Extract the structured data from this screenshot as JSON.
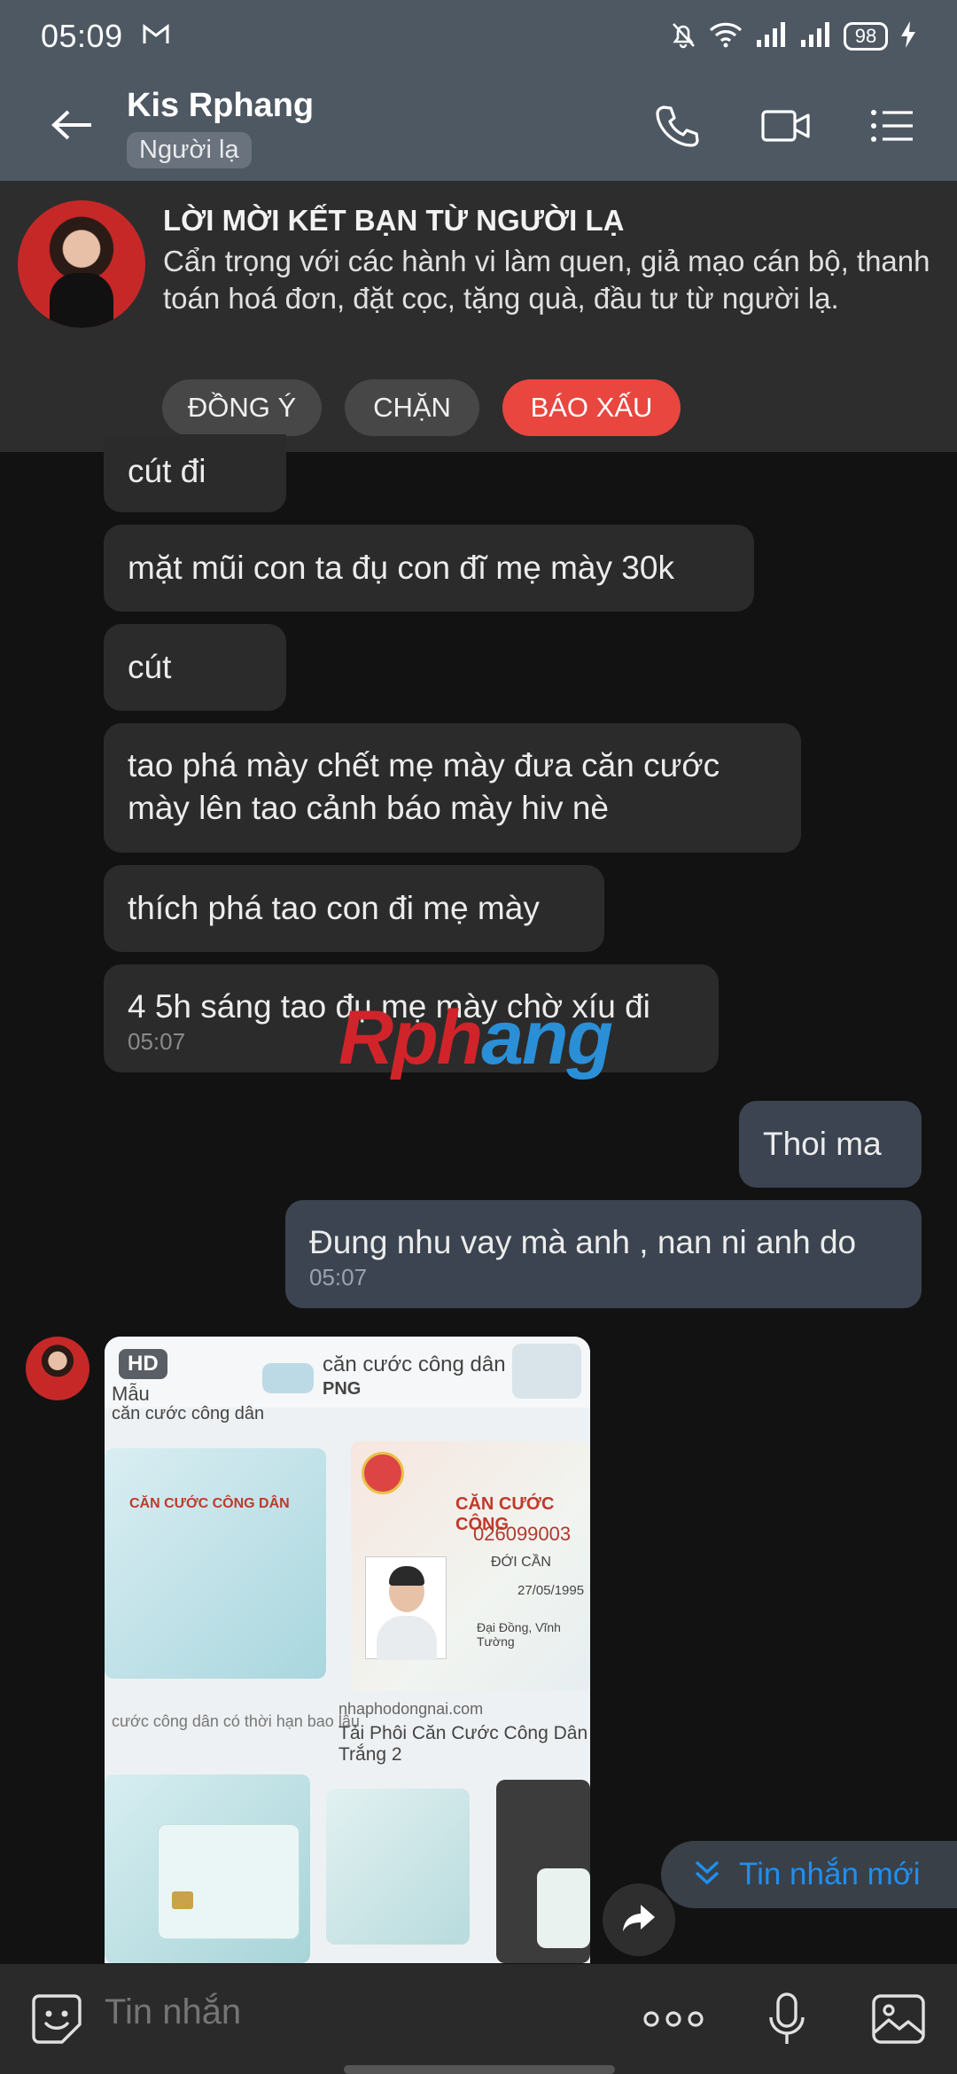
{
  "status_bar": {
    "time": "05:09",
    "battery": "98"
  },
  "header": {
    "contact_name": "Kis Rphang",
    "tag": "Người lạ"
  },
  "banner": {
    "title": "LỜI MỜI KẾT BẠN TỪ NGƯỜI LẠ",
    "text": "Cẩn trọng với các hành vi làm quen, giả mạo cán bộ, thanh toán hoá đơn, đặt cọc, tặng quà, đầu tư từ người lạ.",
    "accept_label": "ĐỒNG Ý",
    "block_label": "CHẶN",
    "report_label": "BÁO XẤU"
  },
  "messages": [
    {
      "from": "them",
      "text": "cút đi"
    },
    {
      "from": "them",
      "text": "mặt mũi con ta đụ con đĩ mẹ mày 30k"
    },
    {
      "from": "them",
      "text": "cút"
    },
    {
      "from": "them",
      "lines": [
        "tao phá mày chết mẹ mày đưa căn cước",
        "mày lên tao cảnh báo mày hiv nè"
      ]
    },
    {
      "from": "them",
      "text": "thích phá tao con đi mẹ mày"
    },
    {
      "from": "them",
      "text": "4 5h sáng tao đụ mẹ mày chờ xíu đi",
      "time": "05:07"
    },
    {
      "from": "me",
      "text": "Thoi ma"
    },
    {
      "from": "me",
      "text": "Đung nhu vay mà anh , nan ni anh do",
      "time": "05:07"
    }
  ],
  "watermark": {
    "part1": "Rph",
    "part2": "ang"
  },
  "photo": {
    "badge": "HD",
    "texts": {
      "t1": "căn cước công dân",
      "t2": "PNG",
      "t3": "Mẫu",
      "t4": "căn cước công dân",
      "t5": "CĂN CƯỚC CÔNG DÂN",
      "t6": "CĂN CƯỚC CÔNG",
      "t7": "026099003",
      "t8": "ĐỚI CẦN",
      "t9": "27/05/1995",
      "t10": "Đại Đồng, Vĩnh Tường",
      "t11": "nhaphodongnai.com",
      "t12": "Tải Phôi Căn Cước Công Dân Trắng 2",
      "t13": "cước công dân có thời hạn bao lâu"
    }
  },
  "new_message_label": "Tin nhắn mới",
  "composer": {
    "placeholder": "Tin nhắn"
  },
  "colors": {
    "header_bg": "#4e5863",
    "banner_bg": "#2d2d2d",
    "report_red": "#e8463f",
    "link_blue": "#1f8ff0",
    "incoming_bubble": "#2b2b2b",
    "outgoing_bubble": "#3b4450"
  },
  "icons": [
    "gmail-icon",
    "bell-off-icon",
    "wifi-icon",
    "signal-icon",
    "battery-icon",
    "charging-icon",
    "back-arrow-icon",
    "phone-icon",
    "video-call-icon",
    "menu-list-icon",
    "share-forward-icon",
    "double-chevron-down-icon",
    "sticker-icon",
    "more-icon",
    "microphone-icon",
    "image-icon"
  ]
}
